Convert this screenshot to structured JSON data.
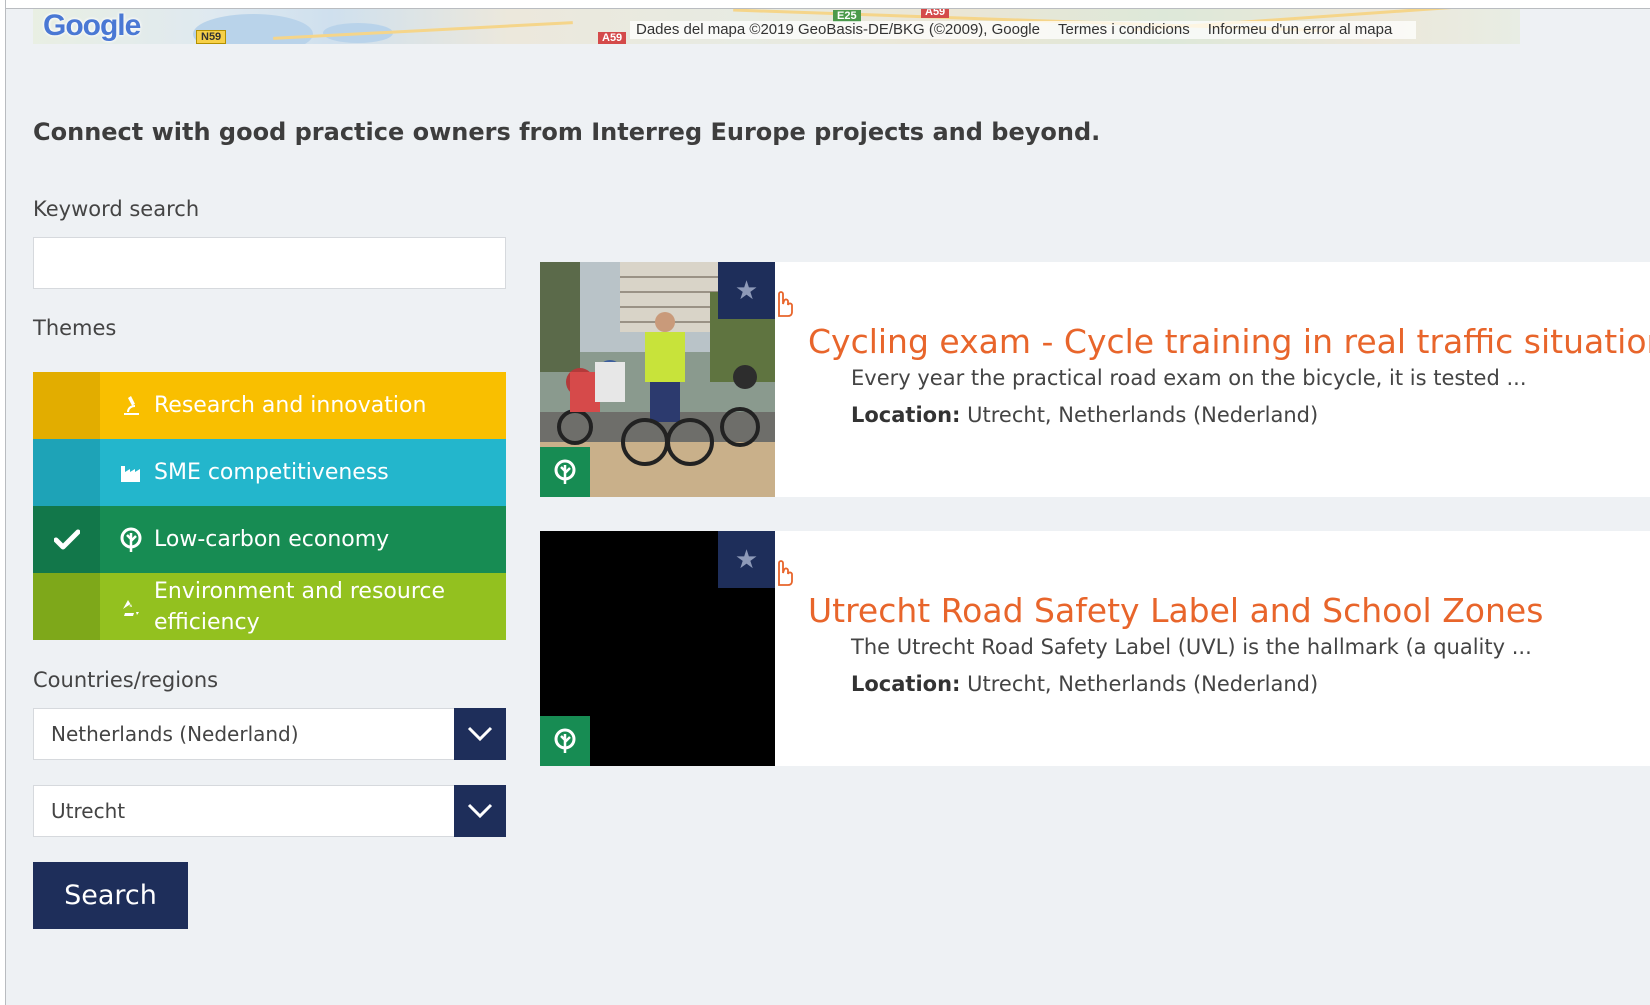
{
  "map": {
    "logo": "Google",
    "road_labels": [
      "N59",
      "A59",
      "E25",
      "A59"
    ],
    "attribution": {
      "data": "Dades del mapa ©2019 GeoBasis-DE/BKG (©2009), Google",
      "terms": "Termes i condicions",
      "report": "Informeu d'un error al mapa"
    }
  },
  "intro": "Connect with good practice owners from Interreg Europe projects and beyond.",
  "filters": {
    "keyword_label": "Keyword search",
    "keyword_value": "",
    "themes_label": "Themes",
    "themes": [
      {
        "label": "Research and innovation",
        "icon": "microscope-icon",
        "color": "#f9bf00",
        "selected": false
      },
      {
        "label": "SME competitiveness",
        "icon": "factory-icon",
        "color": "#23b6cc",
        "selected": false
      },
      {
        "label": "Low-carbon economy",
        "icon": "leaf-icon",
        "color": "#178c53",
        "selected": true
      },
      {
        "label": "Environment and resource efficiency",
        "icon": "recycle-icon",
        "color": "#93c11f",
        "selected": false
      }
    ],
    "countries_label": "Countries/regions",
    "country_value": "Netherlands (Nederland)",
    "region_value": "Utrecht",
    "search_label": "Search"
  },
  "results": [
    {
      "title": "Cycling exam - Cycle training in real traffic situation",
      "description": "Every year the practical road exam on the bicycle, it is tested ...",
      "location_label": "Location:",
      "location": "Utrecht, Netherlands (Nederland)"
    },
    {
      "title": "Utrecht Road Safety Label and School Zones",
      "description": "The Utrecht Road Safety Label (UVL) is the hallmark (a quality ...",
      "location_label": "Location:",
      "location": "Utrecht, Netherlands (Nederland)"
    }
  ],
  "colors": {
    "accent_title": "#e8652b",
    "navy": "#1e2e5a",
    "page_bg": "#eef1f4"
  }
}
